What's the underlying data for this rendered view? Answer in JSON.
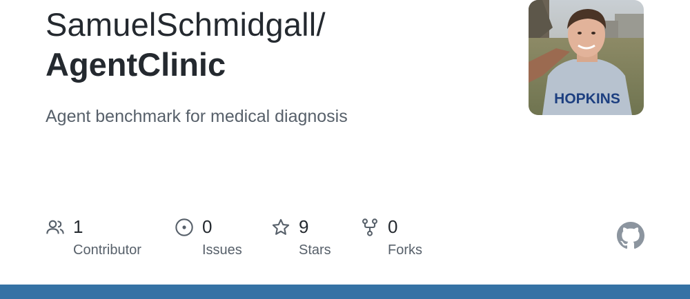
{
  "repo": {
    "owner_path": "SamuelSchmidgall/",
    "name": "AgentClinic",
    "description": "Agent benchmark for medical diagnosis"
  },
  "avatar": {
    "sweater_text": "HOPKINS"
  },
  "stats": [
    {
      "icon": "people-icon",
      "value": "1",
      "label": "Contributor"
    },
    {
      "icon": "issue-icon",
      "value": "0",
      "label": "Issues"
    },
    {
      "icon": "star-icon",
      "value": "9",
      "label": "Stars"
    },
    {
      "icon": "fork-icon",
      "value": "0",
      "label": "Forks"
    }
  ],
  "colors": {
    "text_primary": "#24292f",
    "text_secondary": "#57606a",
    "language_bar": "#3572a5",
    "logo": "#8c959f"
  },
  "logo": "github-mark-icon"
}
